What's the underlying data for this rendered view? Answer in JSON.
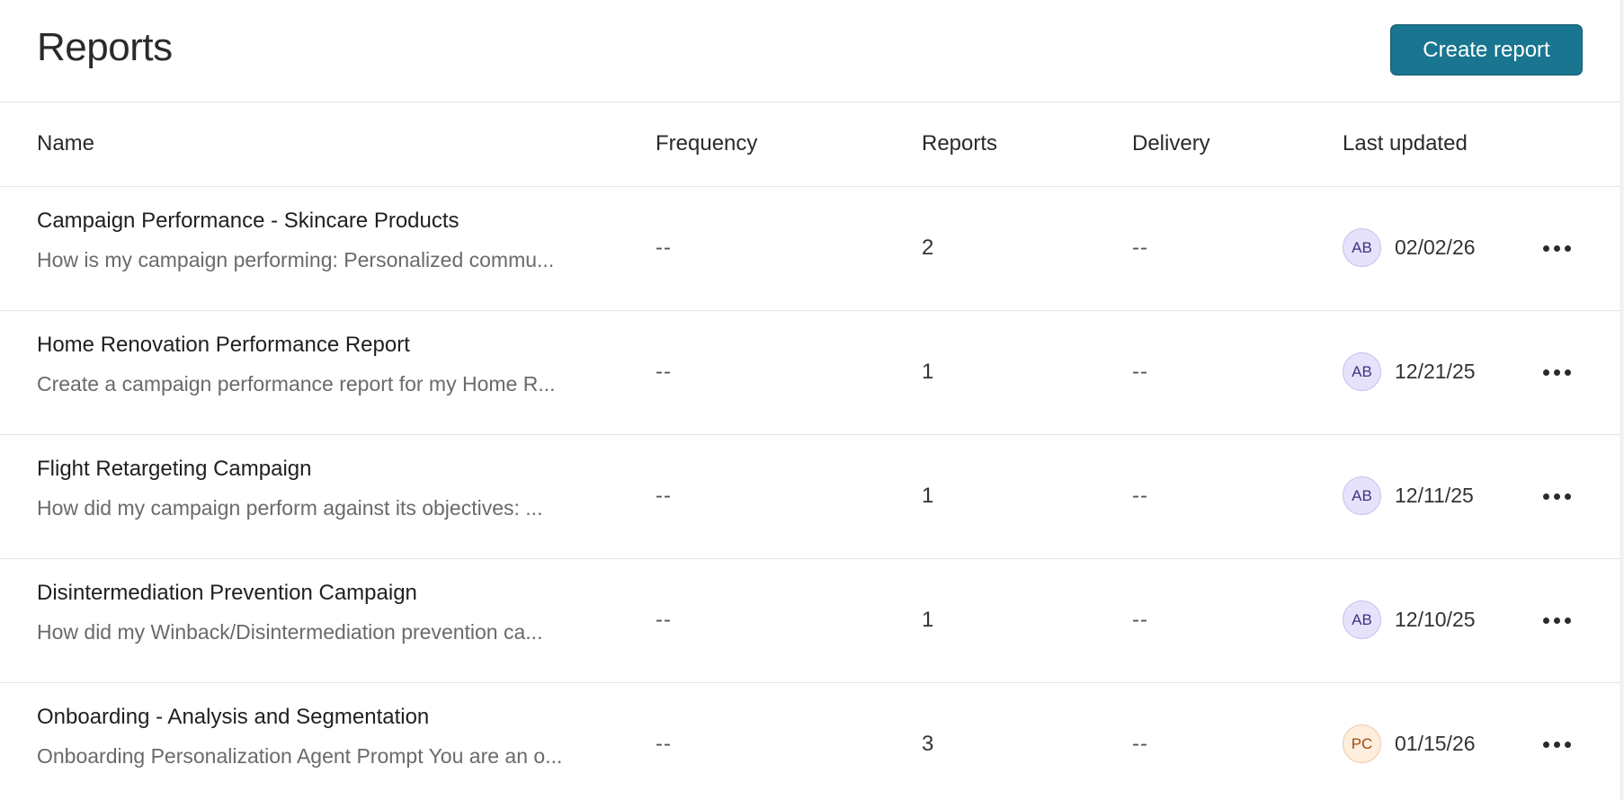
{
  "header": {
    "title": "Reports",
    "create_label": "Create report"
  },
  "columns": {
    "name": "Name",
    "frequency": "Frequency",
    "reports": "Reports",
    "delivery": "Delivery",
    "last_updated": "Last updated"
  },
  "rows": [
    {
      "title": "Campaign Performance - Skincare Products",
      "description": "How is my campaign performing: Personalized commu...",
      "frequency": "--",
      "reports": "2",
      "delivery": "--",
      "avatar": "AB",
      "avatar_color": "#e6e2fb",
      "date": "02/02/26"
    },
    {
      "title": "Home Renovation Performance Report",
      "description": "Create a campaign performance report for my Home R...",
      "frequency": "--",
      "reports": "1",
      "delivery": "--",
      "avatar": "AB",
      "avatar_color": "#e6e2fb",
      "date": "12/21/25"
    },
    {
      "title": "Flight Retargeting Campaign",
      "description": "How did my campaign perform against its objectives: ...",
      "frequency": "--",
      "reports": "1",
      "delivery": "--",
      "avatar": "AB",
      "avatar_color": "#e6e2fb",
      "date": "12/11/25"
    },
    {
      "title": "Disintermediation Prevention Campaign",
      "description": "How did my Winback/Disintermediation prevention ca...",
      "frequency": "--",
      "reports": "1",
      "delivery": "--",
      "avatar": "AB",
      "avatar_color": "#e6e2fb",
      "date": "12/10/25"
    },
    {
      "title": "Onboarding - Analysis and Segmentation",
      "description": "Onboarding Personalization Agent Prompt You are an o...",
      "frequency": "--",
      "reports": "3",
      "delivery": "--",
      "avatar": "PC",
      "avatar_color": "#fdeede",
      "date": "01/15/26"
    }
  ],
  "icons": {
    "row_actions": "more-horizontal-icon"
  },
  "colors": {
    "primary_button": "#1a7690"
  }
}
